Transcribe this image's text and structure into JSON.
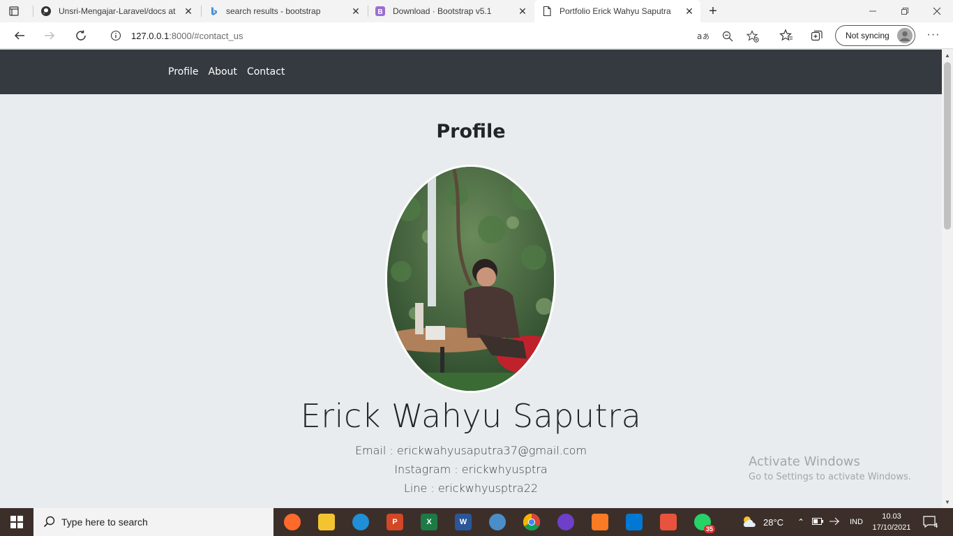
{
  "browser": {
    "tabs": [
      {
        "title": "Unsri-Mengajar-Laravel/docs at",
        "icon": "github-icon"
      },
      {
        "title": "search results - bootstrap",
        "icon": "bing-icon"
      },
      {
        "title": "Download · Bootstrap v5.1",
        "icon": "bootstrap-icon"
      },
      {
        "title": "Portfolio Erick Wahyu Saputra",
        "icon": "page-icon",
        "active": true
      }
    ],
    "address": {
      "host": "127.0.0.1",
      "path": ":8000/#contact_us"
    },
    "sync_label": "Not syncing"
  },
  "page": {
    "nav": {
      "links": [
        "Profile",
        "About",
        "Contact"
      ]
    },
    "heading": "Profile",
    "name": "Erick Wahyu Saputra",
    "email_line": "Email : erickwahyusaputra37@gmail.com",
    "instagram_line": "Instagram : erickwhyusptra",
    "line_line": "Line : erickwhyusptra22"
  },
  "watermark": {
    "line1": "Activate Windows",
    "line2": "Go to Settings to activate Windows."
  },
  "taskbar": {
    "search_placeholder": "Type here to search",
    "weather": "28°C",
    "language": "IND",
    "time": "10.03",
    "date": "17/10/2021",
    "whatsapp_badge": "35",
    "notification_count": "4"
  }
}
